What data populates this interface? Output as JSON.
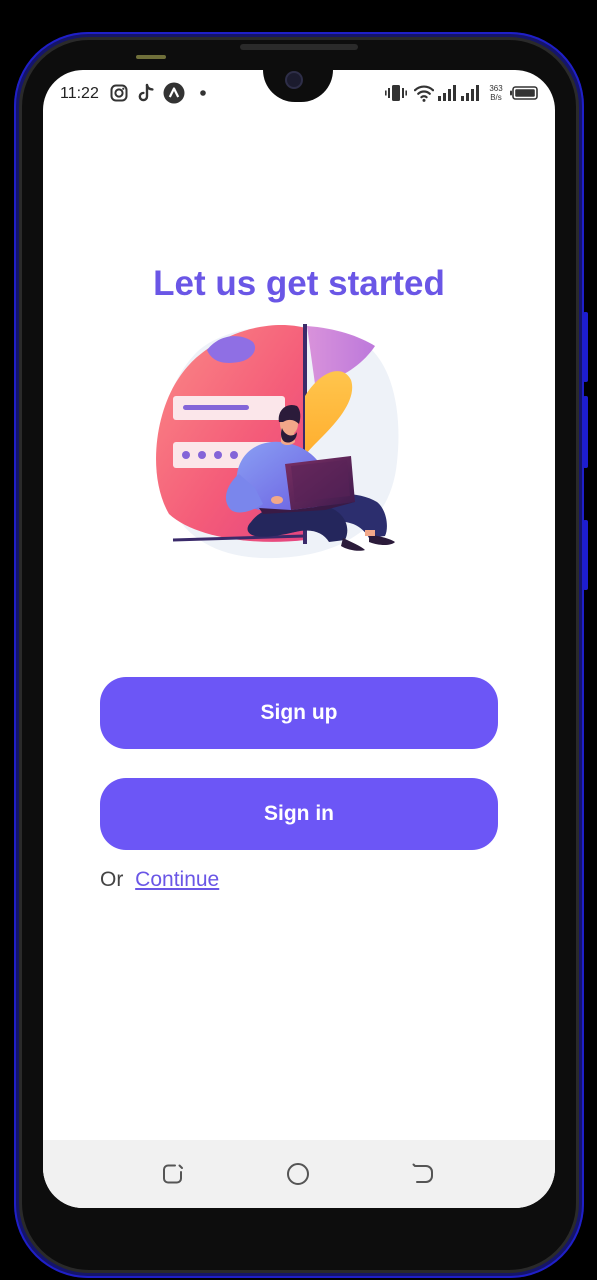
{
  "status_bar": {
    "time": "11:22",
    "net_speed_value": "363",
    "net_speed_unit": "B/s",
    "notification_icons": [
      "instagram-icon",
      "tiktok-icon",
      "app-icon",
      "dot-icon"
    ],
    "system_icons": [
      "vibrate-icon",
      "wifi-icon",
      "signal-icon",
      "signal-icon",
      "battery-icon"
    ]
  },
  "page": {
    "title": "Let us get started"
  },
  "actions": {
    "signup_label": "Sign up",
    "signin_label": "Sign in",
    "or_label": "Or",
    "continue_label": "Continue"
  },
  "nav": {
    "buttons": [
      "recents-icon",
      "home-icon",
      "back-icon"
    ]
  },
  "colors": {
    "accent": "#6c56f6",
    "title": "#6a56e6",
    "nav_background": "#f1f1f1",
    "device_frame": "#1d1dd0"
  }
}
